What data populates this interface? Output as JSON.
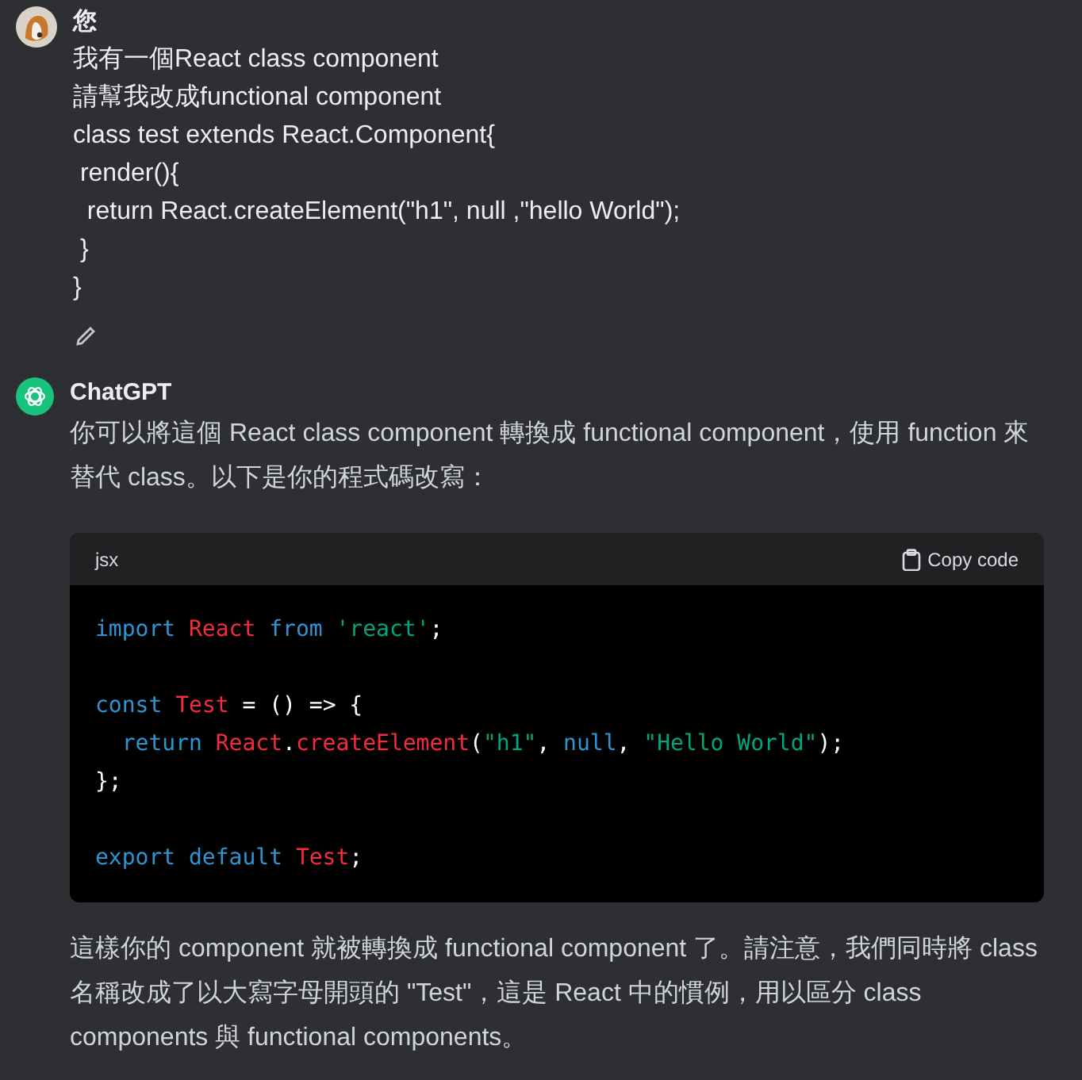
{
  "messages": [
    {
      "kind": "user",
      "author": "您",
      "lines": [
        "我有一個React class component",
        "請幫我改成functional component",
        "class test extends React.Component{",
        " render(){",
        "  return React.createElement(\"h1\", null ,\"hello World\");",
        " }",
        "}"
      ]
    },
    {
      "kind": "assistant",
      "author": "ChatGPT",
      "intro": "你可以將這個 React class component 轉換成 functional component，使用 function 來替代 class。以下是你的程式碼改寫：",
      "code": {
        "language": "jsx",
        "copy_label": "Copy code",
        "groups": [
          {
            "lines": [
              [
                {
                  "kind": "keyword",
                  "text": "import"
                },
                {
                  "kind": "name",
                  "text": " React"
                },
                {
                  "kind": "keyword",
                  "text": " from"
                },
                {
                  "kind": "string",
                  "text": " 'react'"
                },
                {
                  "kind": "plain",
                  "text": ";"
                }
              ]
            ]
          },
          {
            "lines": [
              [
                {
                  "kind": "keyword",
                  "text": "const"
                },
                {
                  "kind": "name",
                  "text": " Test"
                },
                {
                  "kind": "plain",
                  "text": " = () => {"
                }
              ],
              [
                {
                  "kind": "keyword",
                  "text": "  return"
                },
                {
                  "kind": "name",
                  "text": " React"
                },
                {
                  "kind": "plain",
                  "text": "."
                },
                {
                  "kind": "name",
                  "text": "createElement"
                },
                {
                  "kind": "plain",
                  "text": "("
                },
                {
                  "kind": "string",
                  "text": "\"h1\""
                },
                {
                  "kind": "plain",
                  "text": ","
                },
                {
                  "kind": "keyword",
                  "text": " null"
                },
                {
                  "kind": "plain",
                  "text": ","
                },
                {
                  "kind": "string",
                  "text": " \"Hello World\""
                },
                {
                  "kind": "plain",
                  "text": ");"
                }
              ],
              [
                {
                  "kind": "plain",
                  "text": "};"
                }
              ]
            ]
          },
          {
            "lines": [
              [
                {
                  "kind": "keyword",
                  "text": "export"
                },
                {
                  "kind": "keyword",
                  "text": " default"
                },
                {
                  "kind": "name",
                  "text": " Test"
                },
                {
                  "kind": "plain",
                  "text": ";"
                }
              ]
            ]
          }
        ]
      },
      "outro": "這樣你的 component 就被轉換成 functional component 了。請注意，我們同時將 class 名稱改成了以大寫字母開頭的 \"Test\"，這是 React 中的慣例，用以區分 class components 與 functional components。"
    }
  ]
}
